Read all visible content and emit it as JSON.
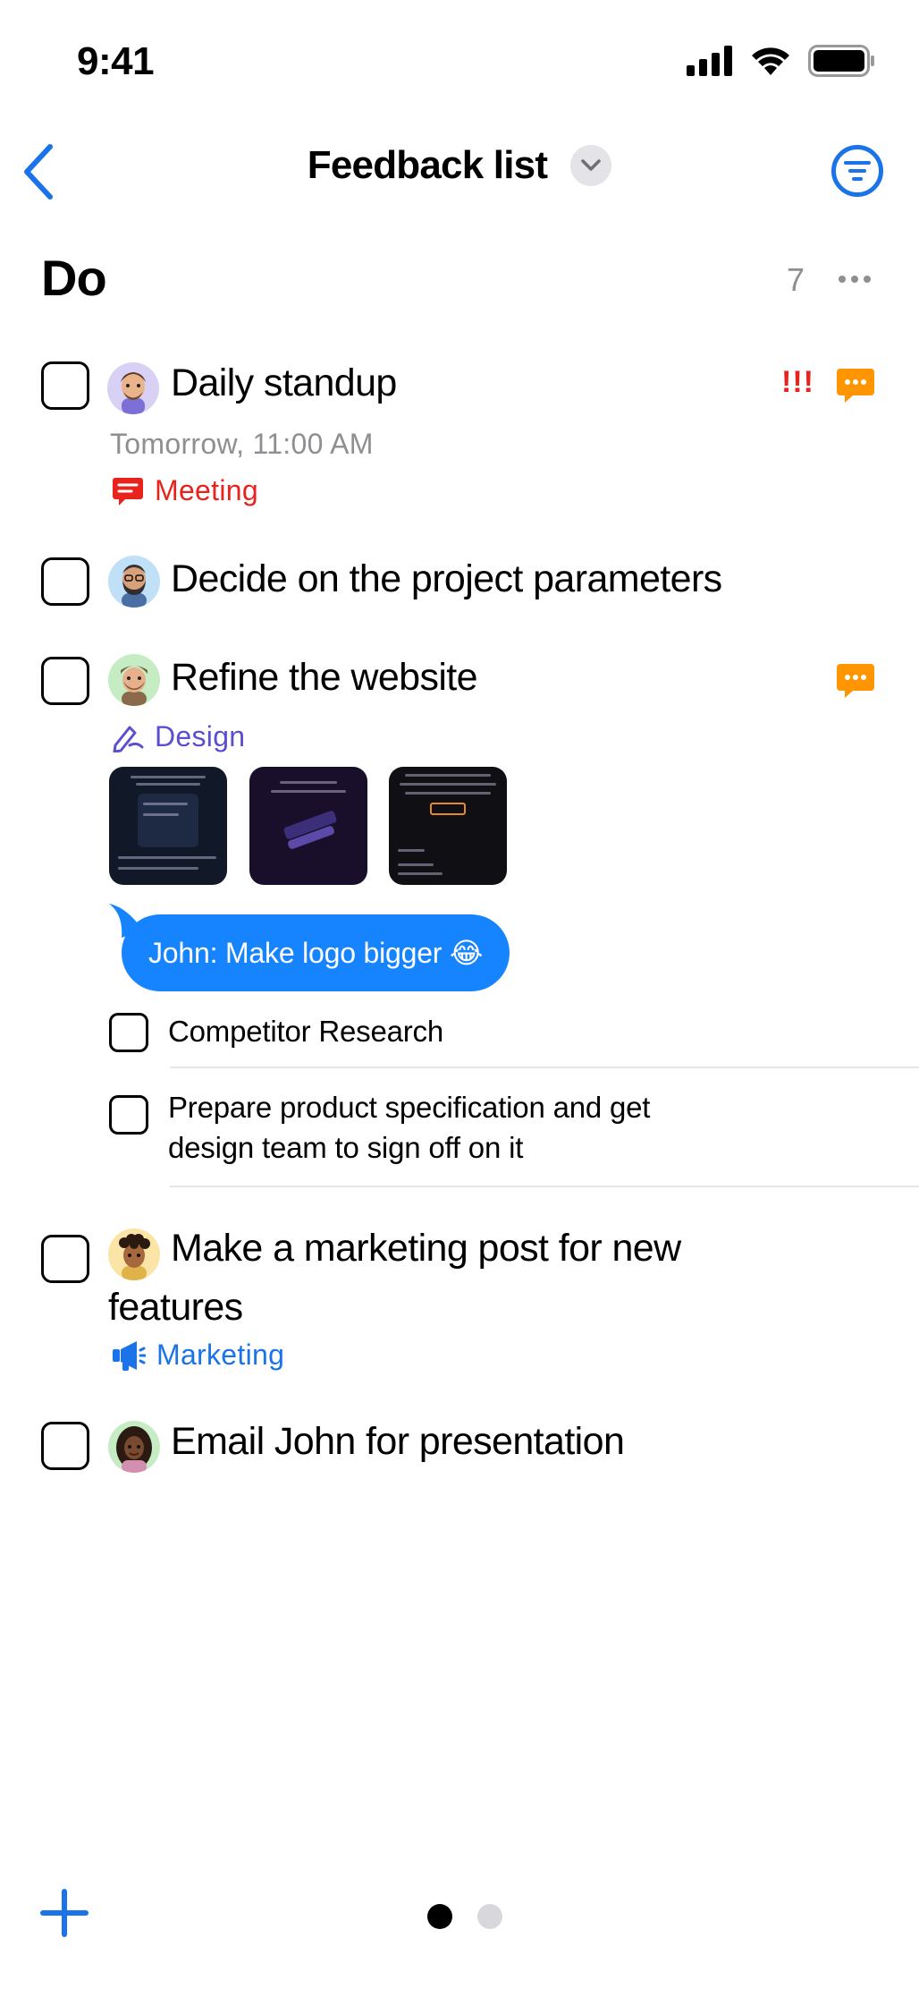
{
  "status_bar": {
    "time": "9:41"
  },
  "nav": {
    "title": "Feedback list"
  },
  "section": {
    "title": "Do",
    "count": "7"
  },
  "tasks": [
    {
      "title": "Daily standup",
      "due": "Tomorrow, 11:00 AM",
      "tag": "Meeting",
      "priority": "!!!",
      "avatar": "memoji-man-glasses",
      "has_comments": true
    },
    {
      "title": "Decide on the project parameters",
      "avatar": "memoji-man-beard"
    },
    {
      "title": "Refine the website",
      "tag": "Design",
      "avatar": "memoji-man-cap",
      "has_comments": true,
      "attachments": [
        "screenshot-1",
        "screenshot-2",
        "screenshot-3"
      ],
      "comment": "John: Make logo bigger 😂",
      "subtasks": [
        {
          "text": "Competitor Research"
        },
        {
          "line1": "Prepare product specification and get",
          "line2": "design team to sign off on it"
        }
      ]
    },
    {
      "title_line1": "Make a marketing post for new",
      "title_line2": "features",
      "tag": "Marketing",
      "avatar": "memoji-curly-hair"
    },
    {
      "title": "Email John for presentation",
      "avatar": "memoji-woman-curly"
    }
  ],
  "colors": {
    "accent": "#1a73e8",
    "meeting": "#e8231d",
    "design": "#5a4fcf",
    "marketing": "#1a73e8",
    "comment_badge": "#ff9500",
    "bubble": "#1784ff"
  },
  "icons": {
    "back": "chevron-left-icon",
    "filter": "filter-icon",
    "more": "ellipsis-icon",
    "add": "plus-icon",
    "meeting": "chat-icon",
    "design": "pen-icon",
    "marketing": "megaphone-icon"
  }
}
